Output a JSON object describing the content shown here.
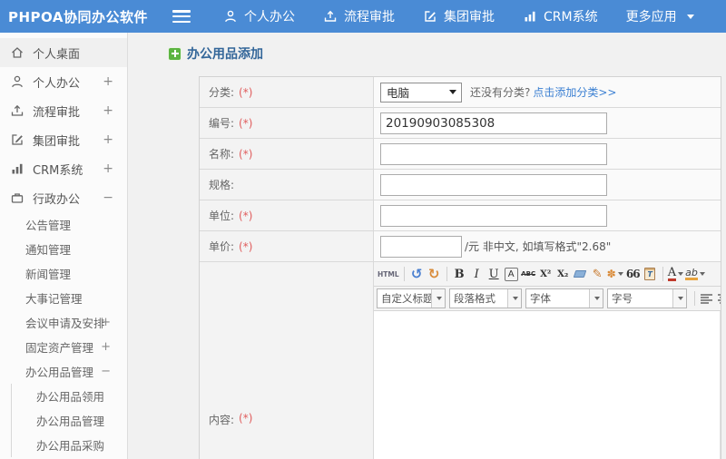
{
  "topbar": {
    "logo": "PHPOA协同办公软件",
    "nav": [
      {
        "label": "个人办公",
        "icon": "person-icon"
      },
      {
        "label": "流程审批",
        "icon": "upload-icon"
      },
      {
        "label": "集团审批",
        "icon": "edit-square-icon"
      },
      {
        "label": "CRM系统",
        "icon": "bar-chart-icon"
      },
      {
        "label": "更多应用",
        "icon": "caret-down-icon"
      }
    ]
  },
  "sidebar": {
    "items": [
      {
        "label": "个人桌面",
        "toggle": "",
        "icon": "home-icon"
      },
      {
        "label": "个人办公",
        "toggle": "+",
        "icon": "person-icon"
      },
      {
        "label": "流程审批",
        "toggle": "+",
        "icon": "upload-icon"
      },
      {
        "label": "集团审批",
        "toggle": "+",
        "icon": "edit-square-icon"
      },
      {
        "label": "CRM系统",
        "toggle": "+",
        "icon": "bar-chart-icon"
      },
      {
        "label": "行政办公",
        "toggle": "−",
        "icon": "briefcase-icon"
      },
      {
        "label": "公告管理",
        "toggle": ""
      },
      {
        "label": "通知管理",
        "toggle": ""
      },
      {
        "label": "新闻管理",
        "toggle": ""
      },
      {
        "label": "大事记管理",
        "toggle": ""
      },
      {
        "label": "会议申请及安排",
        "toggle": "+"
      },
      {
        "label": "固定资产管理",
        "toggle": "+"
      },
      {
        "label": "办公用品管理",
        "toggle": "−"
      },
      {
        "label": "办公用品领用",
        "toggle": ""
      },
      {
        "label": "办公用品管理",
        "toggle": ""
      },
      {
        "label": "办公用品采购",
        "toggle": ""
      }
    ]
  },
  "main": {
    "title": "办公用品添加"
  },
  "form": {
    "category": {
      "selected": "电脑",
      "hint": "还没有分类?",
      "link": "点击添加分类>>"
    },
    "rows": [
      {
        "label": "分类:",
        "required": "(*)"
      },
      {
        "label": "编号:",
        "required": "(*)",
        "value": "20190903085308"
      },
      {
        "label": "名称:",
        "required": "(*)",
        "value": ""
      },
      {
        "label": "规格:",
        "required": "",
        "value": ""
      },
      {
        "label": "单位:",
        "required": "(*)",
        "value": ""
      },
      {
        "label": "单价:",
        "required": "(*)",
        "value": "",
        "suffix": "/元 非中文, 如填写格式\"2.68\""
      },
      {
        "label": "内容:",
        "required": "(*)"
      }
    ]
  },
  "editor": {
    "html_btn": "HTML",
    "undo_glyph": "↺",
    "redo_glyph": "↻",
    "bold": "B",
    "italic": "I",
    "underline": "U",
    "border_a": "A",
    "strike": "ABC",
    "sup": "X²",
    "sub": "X₂",
    "brush_glyph": "✎",
    "wand_glyph": "✽",
    "quote": "66",
    "clip_letter": "T",
    "font_color": "A",
    "bg_color": "ab",
    "link_glyph": "∞",
    "dropdowns": [
      "自定义标题",
      "段落格式",
      "字体",
      "字号"
    ]
  },
  "colors": {
    "topbar_blue": "#4a8bd5",
    "title_blue": "#336699",
    "link_blue": "#3a7fd2",
    "required_red": "#e05c5c",
    "plus_green": "#5cb441"
  }
}
